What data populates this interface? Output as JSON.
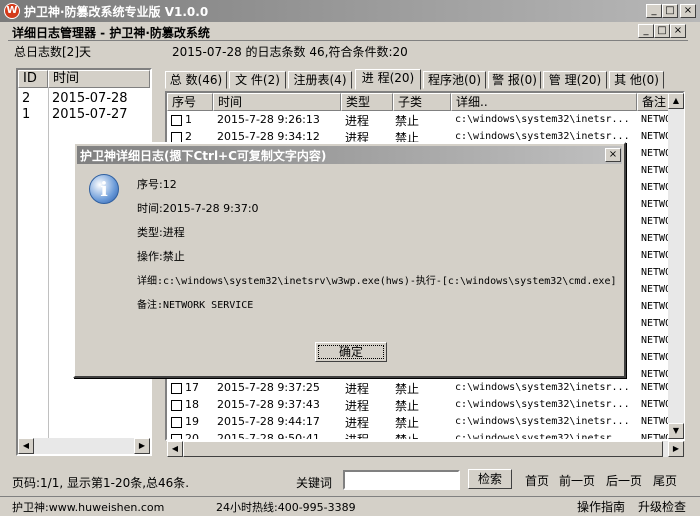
{
  "app": {
    "title": "护卫神·防篡改系统专业版 V1.0.0",
    "minimize": "_",
    "maximize": "□",
    "close": "×"
  },
  "child_window": {
    "title": "详细日志管理器 - 护卫神·防篡改系统"
  },
  "summary": {
    "total_days": "总日志数[2]天",
    "day_info": "2015-07-28 的日志条数 46,符合条件数:20"
  },
  "left_list": {
    "headers": [
      "ID",
      "时间"
    ],
    "rows": [
      {
        "id": "2",
        "date": "2015-07-28"
      },
      {
        "id": "1",
        "date": "2015-07-27"
      }
    ]
  },
  "tabs": [
    {
      "label": "总 数(46)"
    },
    {
      "label": "文 件(2)"
    },
    {
      "label": "注册表(4)"
    },
    {
      "label": "进 程(20)"
    },
    {
      "label": "程序池(0)"
    },
    {
      "label": "警 报(0)"
    },
    {
      "label": "管 理(20)"
    },
    {
      "label": "其 他(0)"
    }
  ],
  "grid": {
    "headers": [
      "序号",
      "时间",
      "类型",
      "子类",
      "详细..",
      "备注"
    ],
    "rows": [
      {
        "num": "1",
        "time": "2015-7-28 9:26:13",
        "type": "进程",
        "sub": "禁止",
        "detail": "c:\\windows\\system32\\inetsr...",
        "note": "NETWO"
      },
      {
        "num": "2",
        "time": "2015-7-28 9:34:12",
        "type": "进程",
        "sub": "禁止",
        "detail": "c:\\windows\\system32\\inetsr...",
        "note": "NETWO"
      },
      {
        "num": "17",
        "time": "2015-7-28 9:37:25",
        "type": "进程",
        "sub": "禁止",
        "detail": "c:\\windows\\system32\\inetsr...",
        "note": "NETWO"
      },
      {
        "num": "18",
        "time": "2015-7-28 9:37:43",
        "type": "进程",
        "sub": "禁止",
        "detail": "c:\\windows\\system32\\inetsr...",
        "note": "NETWO"
      },
      {
        "num": "19",
        "time": "2015-7-28 9:44:17",
        "type": "进程",
        "sub": "禁止",
        "detail": "c:\\windows\\system32\\inetsr...",
        "note": "NETWO"
      },
      {
        "num": "20",
        "time": "2015-7-28 9:50:41",
        "type": "进程",
        "sub": "禁止",
        "detail": "c:\\windows\\system32\\inetsr...",
        "note": "NETWO"
      }
    ],
    "hidden_note": "NETWO"
  },
  "pager": {
    "info": "页码:1/1, 显示第1-20条,总46条.",
    "keyword_label": "关键词",
    "keyword_value": "",
    "search": "检索",
    "first": "首页",
    "prev": "前一页",
    "next": "后一页",
    "last": "尾页"
  },
  "status": {
    "site": "护卫神:www.huweishen.com",
    "hotline": "24小时热线:400-995-3389",
    "guide": "操作指南",
    "upgrade": "升级检查"
  },
  "dialog": {
    "title": "护卫神详细日志(摁下Ctrl+C可复制文字内容)",
    "close": "×",
    "icon": "i",
    "lines": [
      "序号:12",
      "时间:2015-7-28 9:37:0",
      "类型:进程",
      "操作:禁止",
      "详细:c:\\windows\\system32\\inetsrv\\w3wp.exe(hws)-执行-[c:\\windows\\system32\\cmd.exe]",
      "备注:NETWORK SERVICE"
    ],
    "ok": "确定"
  }
}
